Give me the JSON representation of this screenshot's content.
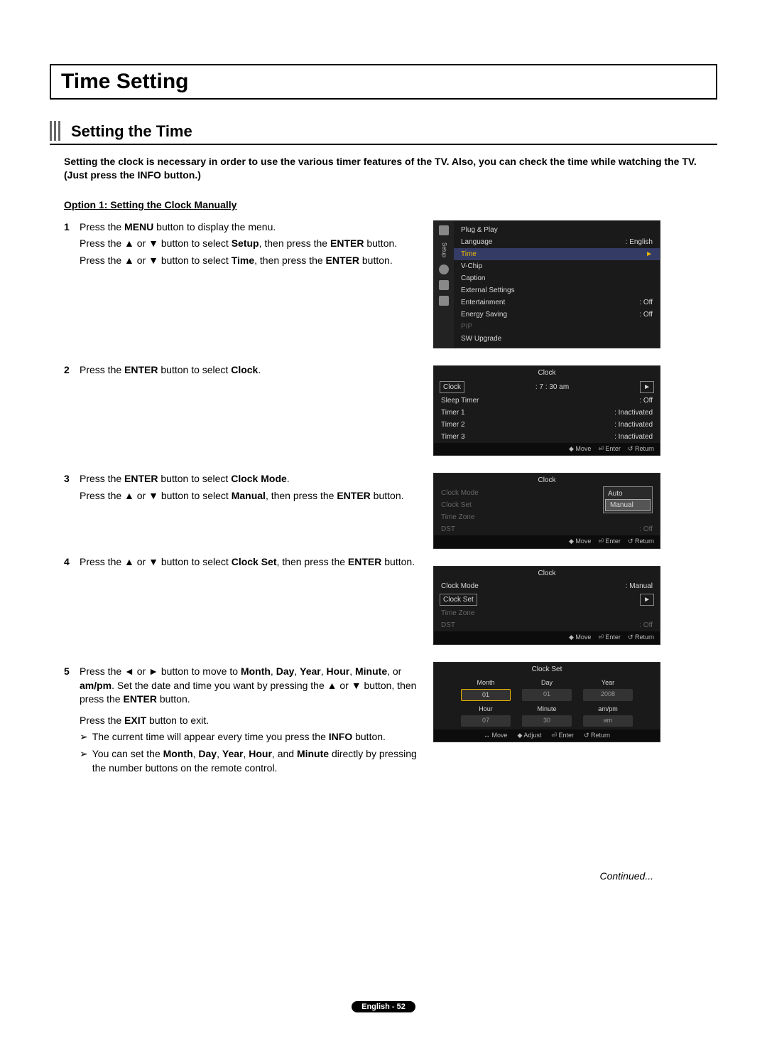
{
  "title": "Time Setting",
  "subtitle": "Setting the Time",
  "intro": "Setting the clock is necessary in order to use the various timer features of the TV. Also, you can check the time while watching the TV. (Just press the INFO button.)",
  "option_header": "Option 1: Setting the Clock Manually",
  "steps": {
    "s1": {
      "num": "1",
      "l1a": "Press the ",
      "l1b": "MENU",
      "l1c": " button to display the menu.",
      "l2a": "Press the ▲ or ▼ button to select ",
      "l2b": "Setup",
      "l2c": ", then press the ",
      "l2d": "ENTER",
      "l2e": " button.",
      "l3a": "Press the ▲ or ▼ button to select ",
      "l3b": "Time",
      "l3c": ", then press the ",
      "l3d": "ENTER",
      "l3e": " button."
    },
    "s2": {
      "num": "2",
      "a": "Press the ",
      "b": "ENTER",
      "c": " button to select ",
      "d": "Clock",
      "e": "."
    },
    "s3": {
      "num": "3",
      "l1a": "Press the ",
      "l1b": "ENTER",
      "l1c": " button to select ",
      "l1d": "Clock Mode",
      "l1e": ".",
      "l2a": "Press the ▲ or ▼ button to select ",
      "l2b": "Manual",
      "l2c": ", then press the ",
      "l2d": "ENTER",
      "l2e": " button."
    },
    "s4": {
      "num": "4",
      "a": "Press the ▲ or ▼ button to select ",
      "b": "Clock Set",
      "c": ", then press the ",
      "d": "ENTER",
      "e": " button."
    },
    "s5": {
      "num": "5",
      "l1a": "Press the ◄ or ► button to move to ",
      "m1": "Month",
      "c1": ", ",
      "m2": "Day",
      "c2": ", ",
      "m3": "Year",
      "c3": ", ",
      "m4": "Hour",
      "c4": ", ",
      "m5": "Minute",
      "c5": ", or ",
      "m6": "am/pm",
      "l1b": ". Set the date and time you want by pressing the ▲ or ▼ button, then press the ",
      "l1c": "ENTER",
      "l1d": " button.",
      "l2a": "Press the ",
      "l2b": "EXIT",
      "l2c": " button to exit.",
      "n1a": "The current time will appear every time you press the ",
      "n1b": "INFO",
      "n1c": " button.",
      "n2a": "You can set the ",
      "n2m1": "Month",
      "n2c1": ", ",
      "n2m2": "Day",
      "n2c2": ", ",
      "n2m3": "Year",
      "n2c3": ", ",
      "n2m4": "Hour",
      "n2c4": ", and ",
      "n2m5": "Minute",
      "n2b": " directly by pressing the number buttons on the remote control."
    }
  },
  "osd": {
    "setup": {
      "tab": "Setup",
      "items": [
        {
          "label": "Plug & Play",
          "value": ""
        },
        {
          "label": "Language",
          "value": ": English"
        },
        {
          "label": "Time",
          "value": "►",
          "sel": true
        },
        {
          "label": "V-Chip",
          "value": ""
        },
        {
          "label": "Caption",
          "value": ""
        },
        {
          "label": "External Settings",
          "value": ""
        },
        {
          "label": "Entertainment",
          "value": ": Off"
        },
        {
          "label": "Energy Saving",
          "value": ": Off"
        },
        {
          "label": "PIP",
          "value": "",
          "dim": true
        },
        {
          "label": "SW Upgrade",
          "value": ""
        }
      ]
    },
    "clock_menu": {
      "title": "Clock",
      "rows": [
        {
          "label": "Clock",
          "value": ": 7 : 30 am",
          "boxed": true,
          "arrow": true
        },
        {
          "label": "Sleep Timer",
          "value": ": Off"
        },
        {
          "label": "Timer 1",
          "value": ": Inactivated"
        },
        {
          "label": "Timer 2",
          "value": ": Inactivated"
        },
        {
          "label": "Timer 3",
          "value": ": Inactivated"
        }
      ],
      "footer": {
        "a": "◆ Move",
        "b": "⏎ Enter",
        "c": "↺ Return"
      }
    },
    "clock_mode": {
      "title": "Clock",
      "rows": [
        {
          "label": "Clock Mode",
          "dim": true
        },
        {
          "label": "Clock Set",
          "dim": true
        },
        {
          "label": "Time Zone",
          "dim": true
        },
        {
          "label": "DST",
          "value": ": Off",
          "dim": true
        }
      ],
      "dropdown": {
        "opt1": "Auto",
        "opt2": "Manual"
      },
      "footer": {
        "a": "◆ Move",
        "b": "⏎ Enter",
        "c": "↺ Return"
      }
    },
    "clock_set_menu": {
      "title": "Clock",
      "rows": [
        {
          "label": "Clock Mode",
          "value": ": Manual"
        },
        {
          "label": "Clock Set",
          "boxed": true,
          "arrow": true
        },
        {
          "label": "Time Zone",
          "dim": true
        },
        {
          "label": "DST",
          "value": ": Off",
          "dim": true
        }
      ],
      "footer": {
        "a": "◆ Move",
        "b": "⏎ Enter",
        "c": "↺ Return"
      }
    },
    "clock_set": {
      "title": "Clock Set",
      "fields": {
        "month": {
          "label": "Month",
          "value": "01"
        },
        "day": {
          "label": "Day",
          "value": "01"
        },
        "year": {
          "label": "Year",
          "value": "2008"
        },
        "hour": {
          "label": "Hour",
          "value": "07"
        },
        "minute": {
          "label": "Minute",
          "value": "30"
        },
        "ampm": {
          "label": "am/pm",
          "value": "am"
        }
      },
      "footer": {
        "a": "↔ Move",
        "b": "◆ Adjust",
        "c": "⏎ Enter",
        "d": "↺ Return"
      }
    }
  },
  "continued": "Continued...",
  "page_footer": "English - 52"
}
